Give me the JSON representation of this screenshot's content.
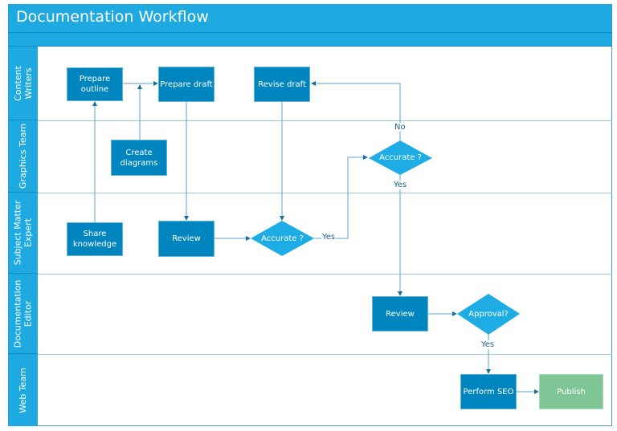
{
  "title": "Documentation Workflow",
  "colors": {
    "header": "#1eaae1",
    "process_box": "#0085bf",
    "decision": "#1dade4",
    "publish": "#80c596",
    "connector": "#4f9fcb"
  },
  "lanes": [
    {
      "label": "Content\nWriters"
    },
    {
      "label": "Graphics Team"
    },
    {
      "label": "Subject Matter\nExpert"
    },
    {
      "label": "Documentation\nEditor"
    },
    {
      "label": "Web Team"
    }
  ],
  "nodes": {
    "prepare_outline": "Prepare\noutline",
    "prepare_draft": "Prepare draft",
    "revise_draft": "Revise draft",
    "create_diagrams": "Create\ndiagrams",
    "share_knowledge": "Share\nknowledge",
    "sme_review": "Review",
    "sme_accurate": "Accurate ?",
    "gfx_accurate": "Accurate ?",
    "editor_review": "Review",
    "approval": "Approval?",
    "perform_seo": "Perform SEO",
    "publish": "Publish"
  },
  "edge_labels": {
    "sme_yes": "Yes",
    "gfx_no": "No",
    "gfx_yes": "Yes",
    "approval_yes": "Yes"
  }
}
